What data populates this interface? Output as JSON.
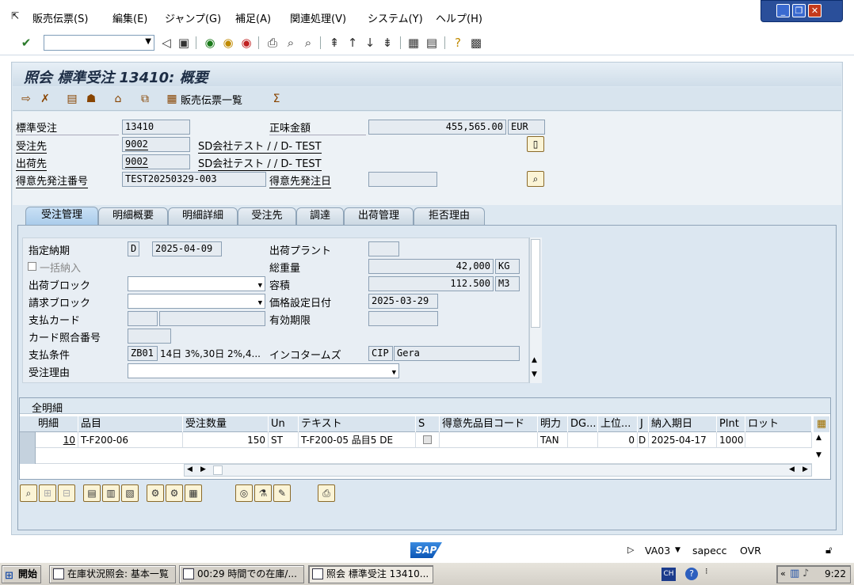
{
  "menu": {
    "items": [
      "販売伝票(S)",
      "編集(E)",
      "ジャンプ(G)",
      "補足(A)",
      "関連処理(V)",
      "システム(Y)",
      "ヘルプ(H)"
    ]
  },
  "title": "照会 標準受注 13410: 概要",
  "app_toolbar": {
    "list_label": "販売伝票一覧"
  },
  "header": {
    "order_type_label": "標準受注",
    "order_no": "13410",
    "net_value_label": "正味金額",
    "net_value": "455,565.00",
    "currency": "EUR",
    "sold_to_label": "受注先",
    "sold_to": "9002",
    "sold_to_name": "SD会社テスト / / D- TEST",
    "ship_to_label": "出荷先",
    "ship_to": "9002",
    "ship_to_name": "SD会社テスト / / D- TEST",
    "po_no_label": "得意先発注番号",
    "po_no": "TEST20250329-003",
    "po_date_label": "得意先発注日",
    "po_date": ""
  },
  "tabs": [
    "受注管理",
    "明細概要",
    "明細詳細",
    "受注先",
    "調達",
    "出荷管理",
    "拒否理由"
  ],
  "sales": {
    "req_deliv_date_label": "指定納期",
    "req_deliv_date_type": "D",
    "req_deliv_date": "2025-04-09",
    "complete_dlv_label": "一括納入",
    "delivery_block_label": "出荷ブロック",
    "billing_block_label": "請求ブロック",
    "payment_card_label": "支払カード",
    "card_verif_label": "カード照合番号",
    "payment_terms_label": "支払条件",
    "payment_terms": "ZB01",
    "payment_terms_text": "14日 3%,30日 2%,4...",
    "order_reason_label": "受注理由",
    "delivering_plant_label": "出荷プラント",
    "total_weight_label": "総重量",
    "total_weight": "42,000",
    "weight_unit": "KG",
    "volume_label": "容積",
    "volume": "112.500",
    "volume_unit": "M3",
    "pricing_date_label": "価格設定日付",
    "pricing_date": "2025-03-29",
    "valid_to_label": "有効期限",
    "incoterms_label": "インコタームズ",
    "incoterms": "CIP",
    "incoterms_place": "Gera"
  },
  "items_table": {
    "title": "全明細",
    "columns": [
      "明細",
      "品目",
      "受注数量",
      "Un",
      "テキスト",
      "S",
      "得意先品目コード",
      "明力",
      "DG...",
      "上位...",
      "J",
      "納入期日",
      "Plnt",
      "ロット"
    ],
    "rows": [
      {
        "item": "10",
        "material": "T-F200-06",
        "qty": "150",
        "unit": "ST",
        "text": "T-F200-05 品目5 DE",
        "category": "TAN",
        "higher": "0",
        "date_type": "D",
        "deliv_date": "2025-04-17",
        "plant": "1000"
      }
    ]
  },
  "status": {
    "tcode": "VA03",
    "server": "sapecc",
    "mode": "OVR"
  },
  "taskbar": {
    "start": "開始",
    "tasks": [
      "在庫状況照会: 基本一覧",
      "00:29 時間での在庫/...",
      "照会 標準受注 13410..."
    ],
    "lang": "CH",
    "time": "9:22"
  }
}
